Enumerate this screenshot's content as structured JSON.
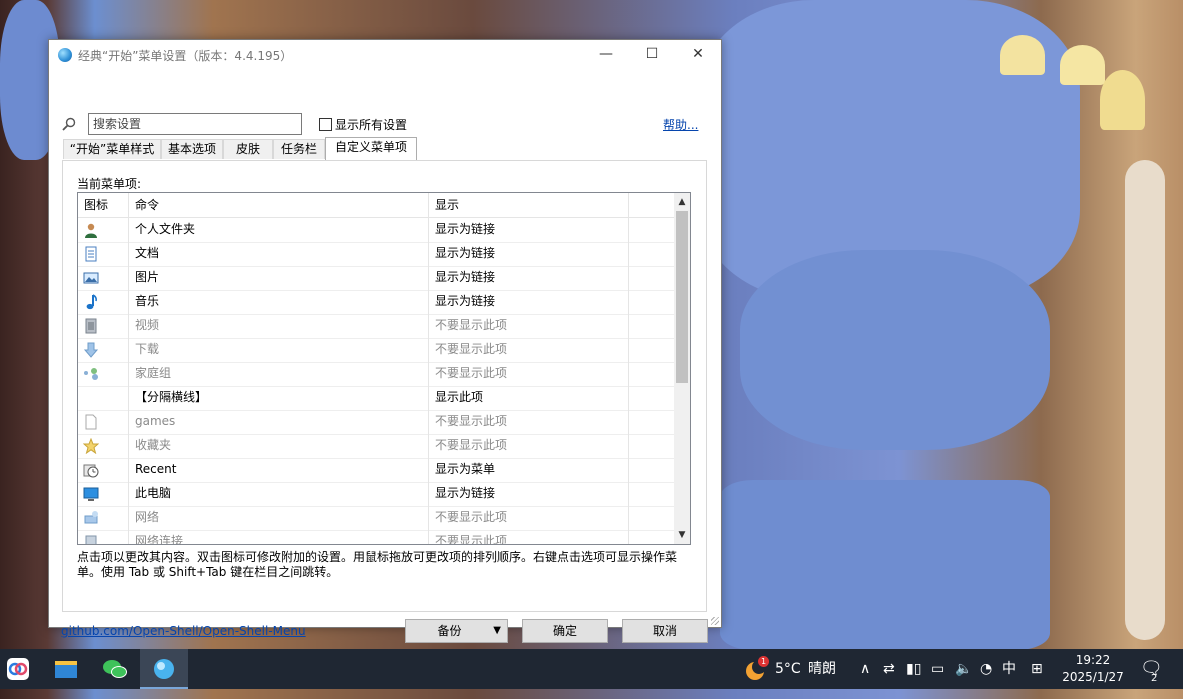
{
  "window": {
    "title": "经典“开始”菜单设置（版本：4.4.195）",
    "minimize": "—",
    "maximize": "☐",
    "close": "✕"
  },
  "toolbar": {
    "search_placeholder": "搜索设置",
    "show_all_label": "显示所有设置",
    "help_link": "帮助..."
  },
  "tabs": [
    "“开始”菜单样式",
    "基本选项",
    "皮肤",
    "任务栏",
    "自定义菜单项"
  ],
  "active_tab": 4,
  "list": {
    "label": "当前菜单项:",
    "headers": [
      "图标",
      "命令",
      "显示"
    ],
    "rows": [
      {
        "icon": "user-folder-icon",
        "command": "个人文件夹",
        "display": "显示为链接",
        "dim": false
      },
      {
        "icon": "document-icon",
        "command": "文档",
        "display": "显示为链接",
        "dim": false
      },
      {
        "icon": "picture-icon",
        "command": "图片",
        "display": "显示为链接",
        "dim": false
      },
      {
        "icon": "music-note-icon",
        "command": "音乐",
        "display": "显示为链接",
        "dim": false
      },
      {
        "icon": "video-icon",
        "command": "视频",
        "display": "不要显示此项",
        "dim": true
      },
      {
        "icon": "download-arrow-icon",
        "command": "下载",
        "display": "不要显示此项",
        "dim": true
      },
      {
        "icon": "homegroup-icon",
        "command": "家庭组",
        "display": "不要显示此项",
        "dim": true
      },
      {
        "icon": "",
        "command": "【分隔横线】",
        "display": "显示此项",
        "dim": false
      },
      {
        "icon": "blank-file-icon",
        "command": "games",
        "display": "不要显示此项",
        "dim": true
      },
      {
        "icon": "star-icon",
        "command": "收藏夹",
        "display": "不要显示此项",
        "dim": true
      },
      {
        "icon": "recent-icon",
        "command": "Recent",
        "display": "显示为菜单",
        "dim": false
      },
      {
        "icon": "computer-icon",
        "command": "此电脑",
        "display": "显示为链接",
        "dim": false
      },
      {
        "icon": "network-icon",
        "command": "网络",
        "display": "不要显示此项",
        "dim": true
      },
      {
        "icon": "network-connections-icon",
        "command": "网络连接",
        "display": "不要显示此项",
        "dim": true
      }
    ]
  },
  "hint_text": "点击项以更改其内容。双击图标可修改附加的设置。用鼠标拖放可更改项的排列顺序。右键点击选项可显示操作菜单。使用 Tab 或 Shift+Tab 键在栏目之间跳转。",
  "footer": {
    "link": "github.com/Open-Shell/Open-Shell-Menu",
    "backup_label": "备份",
    "ok_label": "确定",
    "cancel_label": "取消"
  },
  "taskbar": {
    "weather_temp": "5°C",
    "weather_text": "晴朗",
    "weather_badge": "1",
    "ime": "中",
    "time": "19:22",
    "date": "2025/1/27",
    "notification_count": "2"
  }
}
